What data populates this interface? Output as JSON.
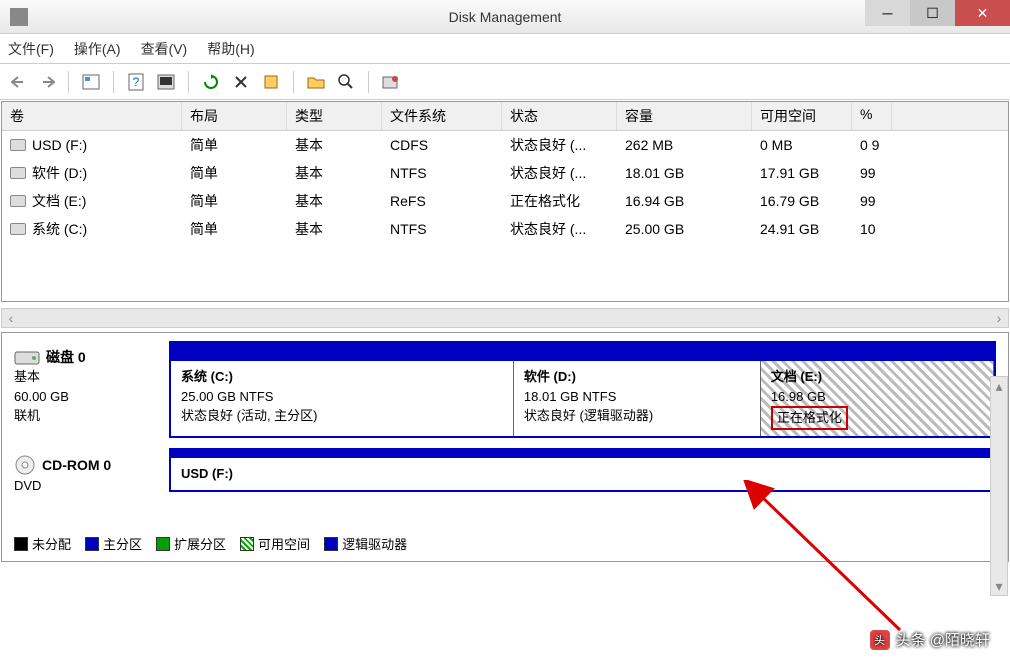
{
  "window": {
    "title": "Disk Management"
  },
  "menu": {
    "file": "文件(F)",
    "action": "操作(A)",
    "view": "查看(V)",
    "help": "帮助(H)"
  },
  "columns": {
    "volume": "卷",
    "layout": "布局",
    "type": "类型",
    "fs": "文件系统",
    "status": "状态",
    "capacity": "容量",
    "free": "可用空间",
    "pct": "%"
  },
  "volumes": [
    {
      "name": "USD (F:)",
      "layout": "简单",
      "type": "基本",
      "fs": "CDFS",
      "status": "状态良好 (...",
      "cap": "262 MB",
      "free": "0 MB",
      "pct": "0 9"
    },
    {
      "name": "软件 (D:)",
      "layout": "简单",
      "type": "基本",
      "fs": "NTFS",
      "status": "状态良好 (...",
      "cap": "18.01 GB",
      "free": "17.91 GB",
      "pct": "99"
    },
    {
      "name": "文档 (E:)",
      "layout": "简单",
      "type": "基本",
      "fs": "ReFS",
      "status": "正在格式化",
      "cap": "16.94 GB",
      "free": "16.79 GB",
      "pct": "99"
    },
    {
      "name": "系统 (C:)",
      "layout": "简单",
      "type": "基本",
      "fs": "NTFS",
      "status": "状态良好 (...",
      "cap": "25.00 GB",
      "free": "24.91 GB",
      "pct": "10"
    }
  ],
  "disk0": {
    "label": "磁盘 0",
    "type": "基本",
    "size": "60.00 GB",
    "status": "联机",
    "partitions": {
      "c": {
        "title": "系统   (C:)",
        "size": "25.00 GB NTFS",
        "status": "状态良好 (活动, 主分区)"
      },
      "d": {
        "title": "软件   (D:)",
        "size": "18.01 GB NTFS",
        "status": "状态良好 (逻辑驱动器)"
      },
      "e": {
        "title": "文档   (E:)",
        "size": "16.98 GB",
        "status": "正在格式化"
      }
    }
  },
  "cdrom": {
    "label": "CD-ROM 0",
    "type": "DVD",
    "usd": "USD   (F:)"
  },
  "legend": {
    "unalloc": "未分配",
    "primary": "主分区",
    "extended": "扩展分区",
    "free": "可用空间",
    "logical": "逻辑驱动器"
  },
  "watermark": "头条 @陌晓轩"
}
